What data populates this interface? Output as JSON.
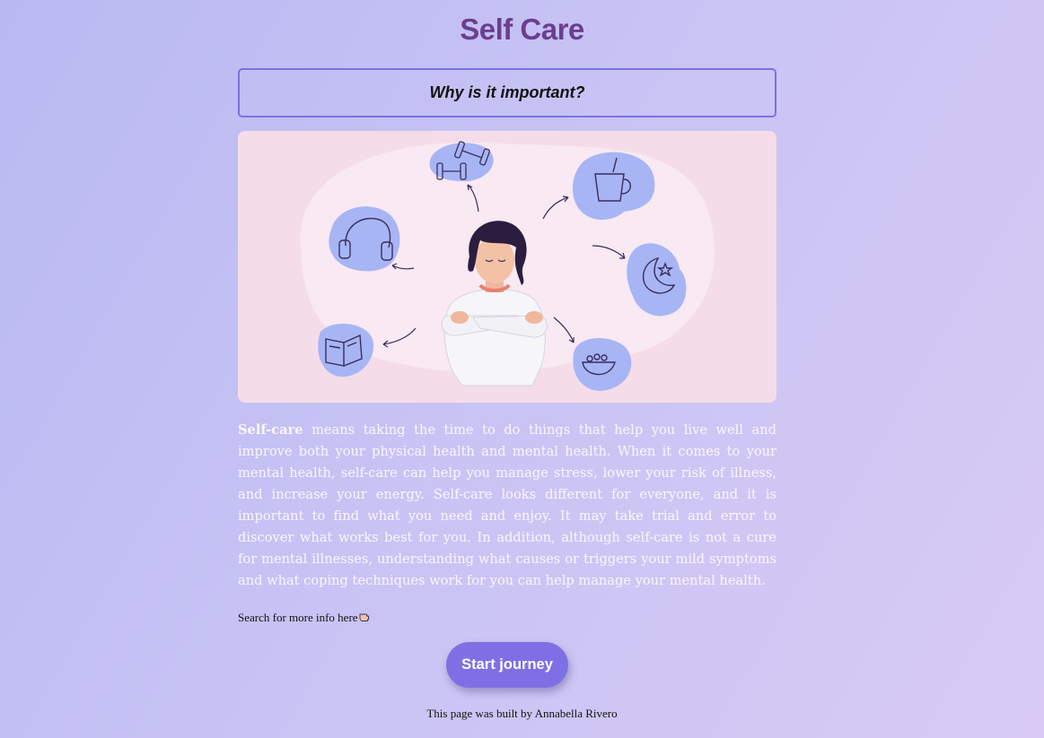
{
  "header": {
    "title": "Self Care"
  },
  "question": {
    "text": "Why is it important?"
  },
  "description": {
    "lead": "Self-care",
    "body": " means taking the time to do things that help you live well and improve both your physical health and mental health. When it comes to your mental health, self-care can help you manage stress, lower your risk of illness, and increase your energy. Self-care looks different for everyone, and it is important to find what you need and enjoy. It may take trial and error to discover what works best for you. In addition, although self-care is not a cure for mental illnesses, understanding what causes or triggers your mild symptoms and what coping techniques work for you can help manage your mental health."
  },
  "search": {
    "label": "Search for more info here",
    "icon": "pointing-hand-icon"
  },
  "cta": {
    "label": "Start journey"
  },
  "footer": {
    "text": "This page was built by Annabella Rivero"
  },
  "colors": {
    "title": "#6c3e8e",
    "accent": "#7e70e4",
    "box_border": "#7b72e0",
    "illustration_bg": "#f4dde9",
    "icon_blob": "#a7b5f5"
  }
}
